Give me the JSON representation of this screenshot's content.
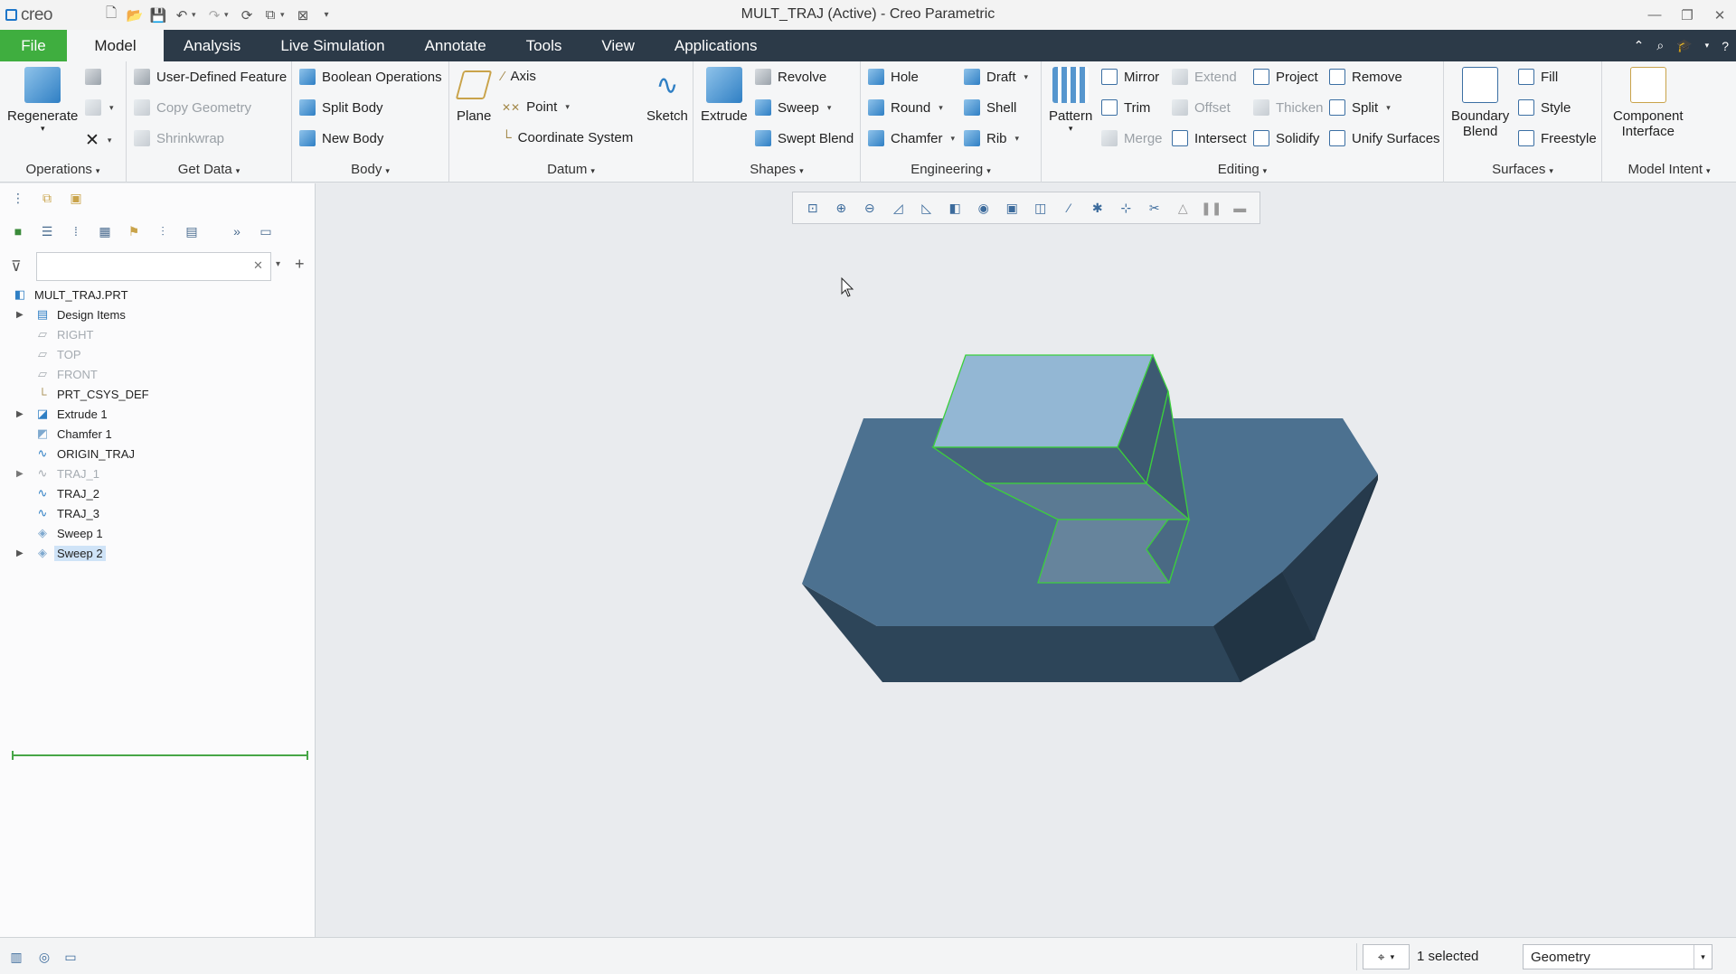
{
  "app": {
    "logo_text": "creo",
    "window_title": "MULT_TRAJ (Active) - Creo Parametric"
  },
  "tabs": [
    {
      "label": "File"
    },
    {
      "label": "Model"
    },
    {
      "label": "Analysis"
    },
    {
      "label": "Live Simulation"
    },
    {
      "label": "Annotate"
    },
    {
      "label": "Tools"
    },
    {
      "label": "View"
    },
    {
      "label": "Applications"
    }
  ],
  "ribbon": {
    "operations": {
      "label": "Operations",
      "regenerate": "Regenerate"
    },
    "get_data": {
      "label": "Get Data",
      "user_defined_feature": "User-Defined Feature",
      "copy_geometry": "Copy Geometry",
      "shrinkwrap": "Shrinkwrap"
    },
    "body": {
      "label": "Body",
      "boolean_operations": "Boolean Operations",
      "split_body": "Split Body",
      "new_body": "New Body"
    },
    "datum": {
      "label": "Datum",
      "plane": "Plane",
      "axis": "Axis",
      "point": "Point",
      "coordinate_system": "Coordinate System",
      "sketch": "Sketch"
    },
    "shapes": {
      "label": "Shapes",
      "extrude": "Extrude",
      "revolve": "Revolve",
      "sweep": "Sweep",
      "swept_blend": "Swept Blend"
    },
    "engineering": {
      "label": "Engineering",
      "hole": "Hole",
      "round": "Round",
      "chamfer": "Chamfer",
      "draft": "Draft",
      "shell": "Shell",
      "rib": "Rib"
    },
    "editing": {
      "label": "Editing",
      "pattern": "Pattern",
      "mirror": "Mirror",
      "trim": "Trim",
      "merge": "Merge",
      "extend": "Extend",
      "offset": "Offset",
      "intersect": "Intersect",
      "project": "Project",
      "thicken": "Thicken",
      "solidify": "Solidify",
      "remove": "Remove",
      "split": "Split",
      "unify_surfaces": "Unify Surfaces"
    },
    "surfaces": {
      "label": "Surfaces",
      "boundary_blend_1": "Boundary",
      "boundary_blend_2": "Blend",
      "fill": "Fill",
      "style": "Style",
      "freestyle": "Freestyle"
    },
    "model_intent": {
      "label": "Model Intent",
      "component_interface_1": "Component",
      "component_interface_2": "Interface"
    }
  },
  "model_tree": {
    "search_placeholder": "",
    "items": [
      {
        "label": "MULT_TRAJ.PRT"
      },
      {
        "label": "Design Items"
      },
      {
        "label": "RIGHT"
      },
      {
        "label": "TOP"
      },
      {
        "label": "FRONT"
      },
      {
        "label": "PRT_CSYS_DEF"
      },
      {
        "label": "Extrude 1"
      },
      {
        "label": "Chamfer 1"
      },
      {
        "label": "ORIGIN_TRAJ"
      },
      {
        "label": "TRAJ_1"
      },
      {
        "label": "TRAJ_2"
      },
      {
        "label": "TRAJ_3"
      },
      {
        "label": "Sweep 1"
      },
      {
        "label": "Sweep 2"
      }
    ]
  },
  "status": {
    "selected": "1 selected",
    "filter": "Geometry"
  },
  "colors": {
    "file_tab": "#3fae3f",
    "tab_bar": "#2c3a48",
    "model_top": "#4c7190",
    "model_side": "#2d4559",
    "sweep_face": "#93b7d4",
    "edge_highlight": "#3ccf3c"
  }
}
